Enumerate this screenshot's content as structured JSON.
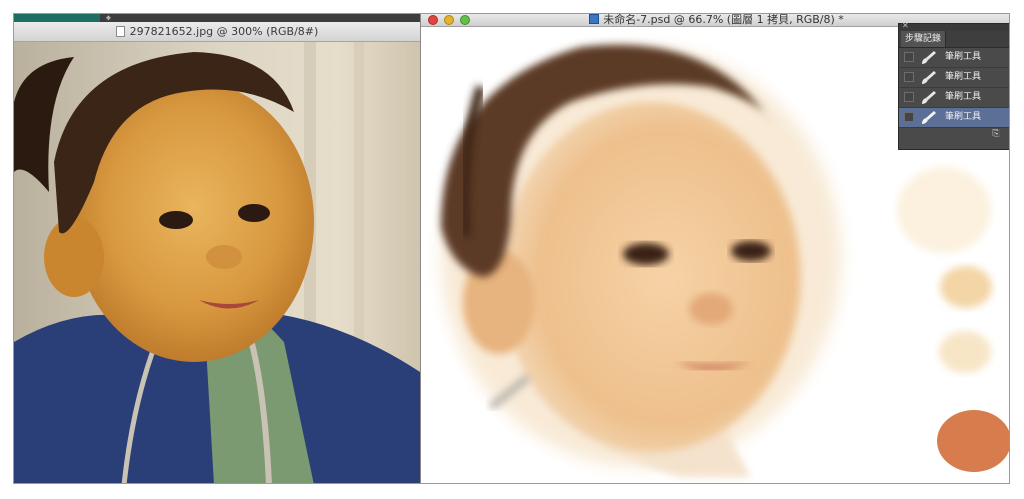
{
  "left_window": {
    "title": "297821652.jpg @ 300% (RGB/8#)",
    "doc_icon": "document-icon",
    "move_tool_icon": "move-tool-icon"
  },
  "right_window": {
    "title": "未命名-7.psd @ 66.7% (圖層 1 拷貝, RGB/8) *",
    "doc_icon": "psd-file-icon"
  },
  "history_panel": {
    "tab_label": "步驟記錄",
    "items": [
      {
        "label": "筆刷工具",
        "icon": "brush-icon",
        "selected": false
      },
      {
        "label": "筆刷工具",
        "icon": "brush-icon",
        "selected": false
      },
      {
        "label": "筆刷工具",
        "icon": "brush-icon",
        "selected": false
      },
      {
        "label": "筆刷工具",
        "icon": "brush-icon",
        "selected": true
      }
    ],
    "footer_icon": "new-snapshot-icon"
  },
  "swatches": [
    {
      "name": "pale-cream",
      "color": "#fbf1de"
    },
    {
      "name": "light-peach",
      "color": "#f3d5a6"
    },
    {
      "name": "pale-peach",
      "color": "#f7e5c6"
    },
    {
      "name": "terracotta",
      "color": "#d77c4c"
    }
  ],
  "colors": {
    "close": "#e0443e",
    "minimize": "#e6b12d",
    "maximize": "#63c04b",
    "history_selected": "#5c6f96"
  }
}
